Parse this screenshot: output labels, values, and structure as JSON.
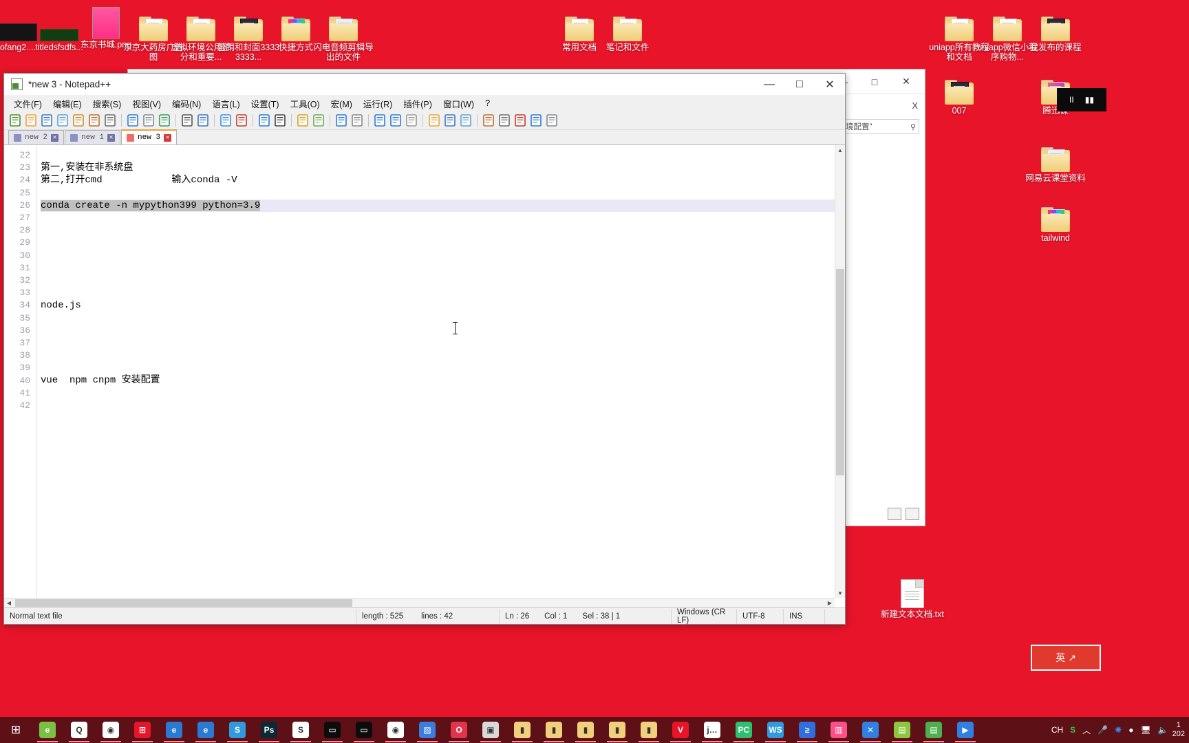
{
  "desktop": {
    "background_color": "#e8142a",
    "icons_top_left": [
      {
        "label": "ofang2....",
        "type": "image-dark"
      },
      {
        "label": "titledsfsdfs...",
        "type": "image-dark2"
      },
      {
        "label": "东京书城.png",
        "type": "image-pink"
      },
      {
        "label": "东京大药房广告图",
        "type": "folder"
      },
      {
        "label": "虚拟环境公用部分和重要...",
        "type": "folder"
      },
      {
        "label": "营销和封面33333333...",
        "type": "folder-book"
      },
      {
        "label": "快捷方式",
        "type": "folder-color"
      },
      {
        "label": "闪电音频剪辑导出的文件",
        "type": "folder-blue"
      }
    ],
    "icons_top_mid": [
      {
        "label": "常用文档",
        "type": "folder"
      },
      {
        "label": "笔记和文件",
        "type": "folder"
      }
    ],
    "icons_top_right": [
      {
        "label": "uniapp所有教程和文档",
        "type": "folder"
      },
      {
        "label": "uniapp微信小程序购物...",
        "type": "folder"
      },
      {
        "label": "我发布的课程",
        "type": "folder-book"
      }
    ],
    "icons_right_col": [
      {
        "label": "007",
        "type": "folder-book"
      },
      {
        "label": "腾迅课",
        "type": "folder-mag"
      },
      {
        "label": "网易云课堂资料",
        "type": "folder-blue"
      },
      {
        "label": "tailwind",
        "type": "folder-color"
      }
    ],
    "icons_bottom_right": [
      {
        "label": "新建文本文档.txt",
        "type": "textfile"
      }
    ]
  },
  "background_window": {
    "minimize_label": "—",
    "maximize_label": "□",
    "close_label": "✕",
    "secondary_close_label": "X",
    "chevron_label": "⌄",
    "help_label": "?",
    "search_value": "境配置\"",
    "search_icon": "search-icon"
  },
  "pause_overlay": {
    "pause_label": "II",
    "next_label": "▮▮"
  },
  "ime_flyout": {
    "text": "英",
    "mark": "↗"
  },
  "notepad": {
    "title": "*new 3 - Notepad++",
    "window_controls": {
      "minimize": "—",
      "maximize": "□",
      "close": "✕"
    },
    "menu": [
      "文件(F)",
      "编辑(E)",
      "搜索(S)",
      "视图(V)",
      "编码(N)",
      "语言(L)",
      "设置(T)",
      "工具(O)",
      "宏(M)",
      "运行(R)",
      "插件(P)",
      "窗口(W)",
      "?"
    ],
    "toolbar_icons": [
      "new-file-icon",
      "open-file-icon",
      "save-icon",
      "save-all-icon",
      "close-file-icon",
      "close-all-icon",
      "print-icon",
      "sep",
      "cut-icon",
      "copy-icon",
      "paste-icon",
      "sep",
      "undo-icon",
      "redo-icon",
      "sep",
      "find-icon",
      "replace-icon",
      "sep",
      "zoom-in-icon",
      "zoom-out-icon",
      "sep",
      "sync-vertical-icon",
      "sync-horizontal-icon",
      "sep",
      "word-wrap-icon",
      "show-all-chars-icon",
      "sep",
      "indent-guide-icon",
      "uppercase-icon",
      "user-language-icon",
      "sep",
      "doc-map-icon",
      "function-list-icon",
      "folder-workspace-icon",
      "sep",
      "record-macro-icon",
      "stop-macro-icon",
      "playback-macro-icon",
      "run-macro-icon",
      "save-macro-icon"
    ],
    "tabs": [
      {
        "label": "new 2",
        "active": false
      },
      {
        "label": "new 1",
        "active": false
      },
      {
        "label": "new 3",
        "active": true
      }
    ],
    "gutter_lines": [
      "22",
      "23",
      "24",
      "25",
      "26",
      "27",
      "28",
      "29",
      "30",
      "31",
      "32",
      "33",
      "34",
      "35",
      "36",
      "37",
      "38",
      "39",
      "40",
      "41",
      "42"
    ],
    "code_lines": [
      {
        "num": "22",
        "text": "",
        "current": false
      },
      {
        "num": "23",
        "text": "第一,安装在非系统盘",
        "current": false
      },
      {
        "num": "24",
        "text": "第二,打开cmd            输入conda -V",
        "current": false
      },
      {
        "num": "25",
        "text": "",
        "current": false
      },
      {
        "num": "26",
        "text": "conda create -n mypython399 python=3.9",
        "current": true,
        "selected": true
      },
      {
        "num": "27",
        "text": "",
        "current": false
      },
      {
        "num": "28",
        "text": "",
        "current": false
      },
      {
        "num": "29",
        "text": "",
        "current": false
      },
      {
        "num": "30",
        "text": "",
        "current": false
      },
      {
        "num": "31",
        "text": "",
        "current": false
      },
      {
        "num": "32",
        "text": "",
        "current": false
      },
      {
        "num": "33",
        "text": "",
        "current": false
      },
      {
        "num": "34",
        "text": "node.js",
        "current": false
      },
      {
        "num": "35",
        "text": "",
        "current": false
      },
      {
        "num": "36",
        "text": "",
        "current": false
      },
      {
        "num": "37",
        "text": "",
        "current": false
      },
      {
        "num": "38",
        "text": "",
        "current": false
      },
      {
        "num": "39",
        "text": "",
        "current": false
      },
      {
        "num": "40",
        "text": "vue  npm cnpm 安装配置",
        "current": false
      },
      {
        "num": "41",
        "text": "",
        "current": false
      },
      {
        "num": "42",
        "text": "",
        "current": false
      }
    ],
    "status": {
      "file_type": "Normal text file",
      "length_label": "length : 525",
      "lines_label": "lines : 42",
      "ln": "Ln : 26",
      "col": "Col : 1",
      "sel": "Sel : 38 | 1",
      "eol": "Windows (CR LF)",
      "encoding": "UTF-8",
      "insert_mode": "INS"
    },
    "scroll": {
      "up_arrow": "▲",
      "down_arrow": "▼",
      "left_arrow": "◀",
      "right_arrow": "▶"
    }
  },
  "taskbar": {
    "start_label": "⊞",
    "items": [
      {
        "name": "edge-legacy",
        "label": "e",
        "color": "#7ac143"
      },
      {
        "name": "quark-browser",
        "label": "Q",
        "color": "#ffffff"
      },
      {
        "name": "chrome",
        "label": "◉",
        "color": "#ffffff"
      },
      {
        "name": "windows-store",
        "label": "⊞",
        "color": "#e8142a"
      },
      {
        "name": "ie-browser",
        "label": "e",
        "color": "#2a7ad4"
      },
      {
        "name": "ie-browser-2",
        "label": "e",
        "color": "#2a7ad4"
      },
      {
        "name": "sogou",
        "label": "S",
        "color": "#2f9ae0"
      },
      {
        "name": "photoshop",
        "label": "Ps",
        "color": "#0b2a36"
      },
      {
        "name": "sublime",
        "label": "S",
        "color": "#ffffff"
      },
      {
        "name": "cmd-1",
        "label": "▭",
        "color": "#0c0c0c"
      },
      {
        "name": "cmd-2",
        "label": "▭",
        "color": "#0c0c0c"
      },
      {
        "name": "chrome-canary",
        "label": "◉",
        "color": "#ffffff"
      },
      {
        "name": "blue-app",
        "label": "▨",
        "color": "#3b7ddd"
      },
      {
        "name": "opera",
        "label": "O",
        "color": "#e2344a"
      },
      {
        "name": "photo-app",
        "label": "▣",
        "color": "#d9d9d9"
      },
      {
        "name": "folder-1",
        "label": "▮",
        "color": "#f2cf7c"
      },
      {
        "name": "folder-2",
        "label": "▮",
        "color": "#f2cf7c"
      },
      {
        "name": "folder-3",
        "label": "▮",
        "color": "#f2cf7c"
      },
      {
        "name": "folder-4",
        "label": "▮",
        "color": "#f2cf7c"
      },
      {
        "name": "folder-5",
        "label": "▮",
        "color": "#f2cf7c"
      },
      {
        "name": "vue-app",
        "label": "V",
        "color": "#e8142a"
      },
      {
        "name": "jetbrains-app",
        "label": "j…",
        "color": "#ffffff"
      },
      {
        "name": "pycharm",
        "label": "PC",
        "color": "#2fbf71"
      },
      {
        "name": "webstorm",
        "label": "WS",
        "color": "#2f9ae0"
      },
      {
        "name": "powershell",
        "label": "≥",
        "color": "#2f6fdd"
      },
      {
        "name": "rainbow-app",
        "label": "▥",
        "color": "#ff4f8b"
      },
      {
        "name": "vscode",
        "label": "✕",
        "color": "#2f80e0"
      },
      {
        "name": "notepad-plus",
        "label": "▤",
        "color": "#8dc63f"
      },
      {
        "name": "green-doc",
        "label": "▤",
        "color": "#4caf50"
      },
      {
        "name": "video-player",
        "label": "▶",
        "color": "#2f80e0"
      }
    ],
    "tray": {
      "ime_label": "CH",
      "sogou_label": "S",
      "chevron": "︿",
      "mic_icon": "microphone-icon",
      "bluetooth_icon": "bluetooth-icon",
      "shield_icon": "shield-icon",
      "network_icon": "network-icon",
      "volume_icon": "volume-icon"
    },
    "clock": {
      "time": "1",
      "date": "202"
    }
  }
}
